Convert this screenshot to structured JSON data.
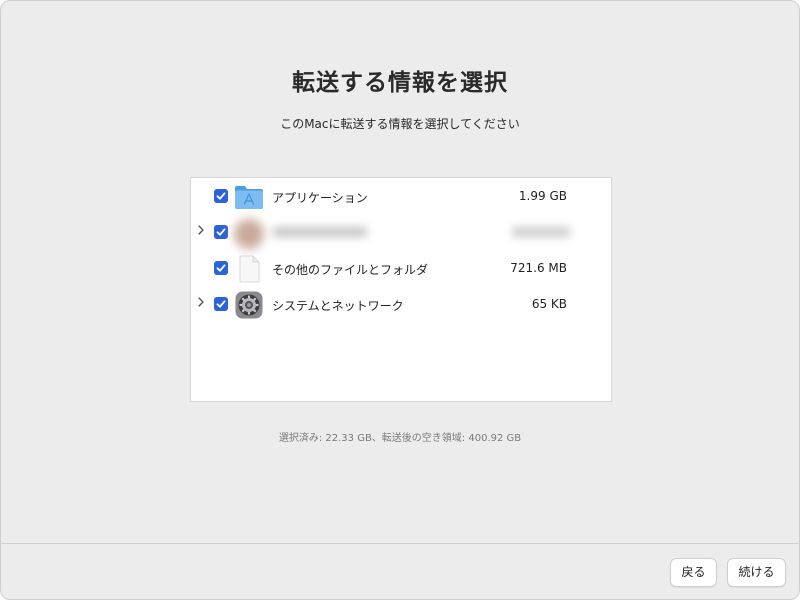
{
  "header": {
    "title": "転送する情報を選択",
    "subtitle": "このMacに転送する情報を選択してください"
  },
  "items": [
    {
      "label": "アプリケーション",
      "size": "1.99 GB",
      "checked": true,
      "expandable": false,
      "icon": "applications-folder-icon"
    },
    {
      "label": "",
      "size": "",
      "checked": true,
      "expandable": true,
      "icon": "user-avatar-icon",
      "redacted": true
    },
    {
      "label": "その他のファイルとフォルダ",
      "size": "721.6 MB",
      "checked": true,
      "expandable": false,
      "icon": "document-icon"
    },
    {
      "label": "システムとネットワーク",
      "size": "65 KB",
      "checked": true,
      "expandable": true,
      "icon": "system-settings-gear-icon"
    }
  ],
  "status": "選択済み: 22.33 GB、転送後の空き領域: 400.92 GB",
  "footer": {
    "back_label": "戻る",
    "continue_label": "続ける"
  },
  "colors": {
    "accent": "#2b64d6",
    "background": "#ececec"
  }
}
